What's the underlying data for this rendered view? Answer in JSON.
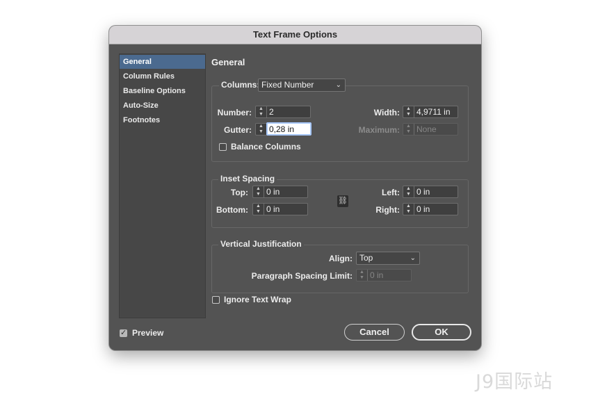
{
  "dialog": {
    "title": "Text Frame Options"
  },
  "sidebar": {
    "items": [
      {
        "label": "General",
        "active": true
      },
      {
        "label": "Column Rules"
      },
      {
        "label": "Baseline Options"
      },
      {
        "label": "Auto-Size"
      },
      {
        "label": "Footnotes"
      }
    ]
  },
  "main": {
    "section_title": "General"
  },
  "columns": {
    "type_label": "Columns:",
    "type_value": "Fixed Number",
    "number_label": "Number:",
    "number_value": "2",
    "gutter_label": "Gutter:",
    "gutter_value": "0,28 in",
    "width_label": "Width:",
    "width_value": "4,9711 in",
    "maximum_label": "Maximum:",
    "maximum_value": "None",
    "balance_label": "Balance Columns",
    "balance_checked": false
  },
  "inset": {
    "title": "Inset Spacing",
    "top_label": "Top:",
    "top_value": "0 in",
    "bottom_label": "Bottom:",
    "bottom_value": "0 in",
    "left_label": "Left:",
    "left_value": "0 in",
    "right_label": "Right:",
    "right_value": "0 in",
    "link_icon": "link-icon"
  },
  "vertical": {
    "title": "Vertical Justification",
    "align_label": "Align:",
    "align_value": "Top",
    "spacing_label": "Paragraph Spacing Limit:",
    "spacing_value": "0 in"
  },
  "ignore_wrap": {
    "label": "Ignore Text Wrap",
    "checked": false
  },
  "footer": {
    "preview_label": "Preview",
    "preview_checked": true,
    "cancel_label": "Cancel",
    "ok_label": "OK"
  },
  "watermark": "J9国际站",
  "colors": {
    "dialog_bg": "#535353",
    "sidebar_active": "#4b6a8f",
    "titlebar": "#d6d3d6"
  }
}
